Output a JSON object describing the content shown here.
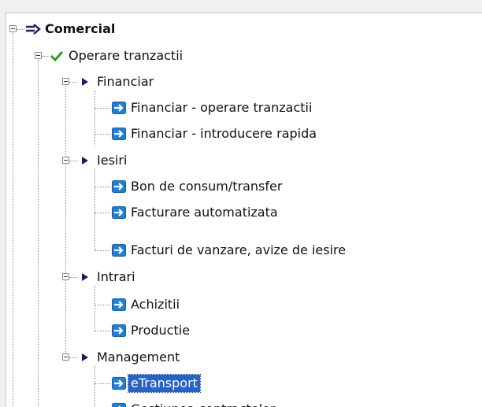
{
  "tree": {
    "root": {
      "label": "Comercial",
      "icon": "double-arrow-icon"
    },
    "level1": {
      "label": "Operare tranzactii",
      "icon": "checkmark-icon"
    },
    "groups": [
      {
        "label": "Financiar",
        "icon": "triangle-arrow-icon",
        "items": [
          "Financiar - operare tranzactii",
          "Financiar - introducere rapida"
        ]
      },
      {
        "label": "Iesiri",
        "icon": "triangle-arrow-icon",
        "items": [
          "Bon de consum/transfer",
          "Facturare automatizata",
          "Facturi de vanzare, avize de iesire"
        ]
      },
      {
        "label": "Intrari",
        "icon": "triangle-arrow-icon",
        "items": [
          "Achizitii",
          "Productie"
        ]
      },
      {
        "label": "Management",
        "icon": "triangle-arrow-icon",
        "items": [
          "eTransport",
          "Gestiunea contractelor"
        ]
      }
    ],
    "selected_item": "eTransport",
    "leaf_icon": "blue-arrow-icon"
  },
  "colors": {
    "selection": "#2563c9",
    "leaf_icon_bg": "#1e7fd8",
    "check": "#2e9b1f",
    "triangle": "#1a1a6e"
  }
}
